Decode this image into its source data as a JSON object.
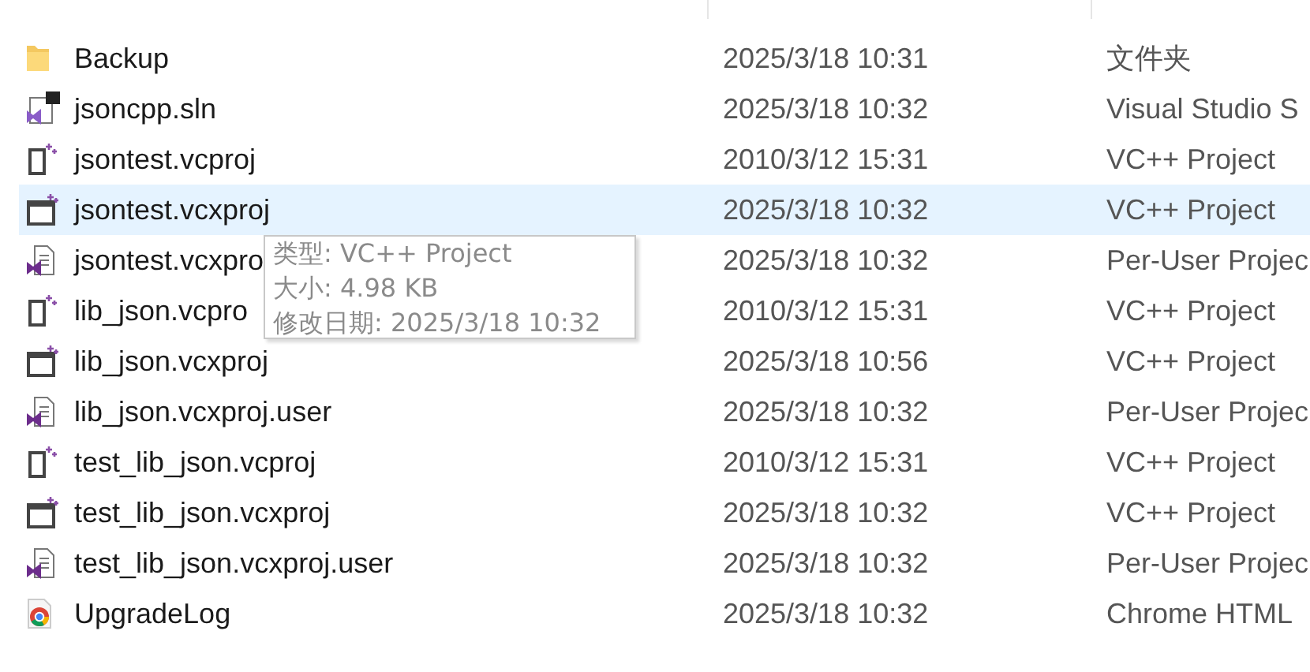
{
  "rows": [
    {
      "kind": "folder",
      "name": "Backup",
      "date": "2025/3/18 10:31",
      "type": "文件夹",
      "hovered": false
    },
    {
      "kind": "sln",
      "name": "jsoncpp.sln",
      "date": "2025/3/18 10:32",
      "type": "Visual Studio S",
      "hovered": false
    },
    {
      "kind": "vcproj",
      "name": "jsontest.vcproj",
      "date": "2010/3/12 15:31",
      "type": "VC++ Project",
      "hovered": false
    },
    {
      "kind": "vcxproj",
      "name": "jsontest.vcxproj",
      "date": "2025/3/18 10:32",
      "type": "VC++ Project",
      "hovered": true
    },
    {
      "kind": "user",
      "name": "jsontest.vcxpro",
      "date": "2025/3/18 10:32",
      "type": "Per-User Projec",
      "hovered": false
    },
    {
      "kind": "vcproj",
      "name": "lib_json.vcpro",
      "date": "2010/3/12 15:31",
      "type": "VC++ Project",
      "hovered": false
    },
    {
      "kind": "vcxproj",
      "name": "lib_json.vcxproj",
      "date": "2025/3/18 10:56",
      "type": "VC++ Project",
      "hovered": false
    },
    {
      "kind": "user",
      "name": "lib_json.vcxproj.user",
      "date": "2025/3/18 10:32",
      "type": "Per-User Projec",
      "hovered": false
    },
    {
      "kind": "vcproj",
      "name": "test_lib_json.vcproj",
      "date": "2010/3/12 15:31",
      "type": "VC++ Project",
      "hovered": false
    },
    {
      "kind": "vcxproj",
      "name": "test_lib_json.vcxproj",
      "date": "2025/3/18 10:32",
      "type": "VC++ Project",
      "hovered": false
    },
    {
      "kind": "user",
      "name": "test_lib_json.vcxproj.user",
      "date": "2025/3/18 10:32",
      "type": "Per-User Projec",
      "hovered": false
    },
    {
      "kind": "chrome",
      "name": "UpgradeLog",
      "date": "2025/3/18 10:32",
      "type": "Chrome HTML",
      "hovered": false
    }
  ],
  "tooltip": {
    "lines": [
      "类型: VC++ Project",
      "大小: 4.98 KB",
      "修改日期: 2025/3/18 10:32"
    ]
  }
}
